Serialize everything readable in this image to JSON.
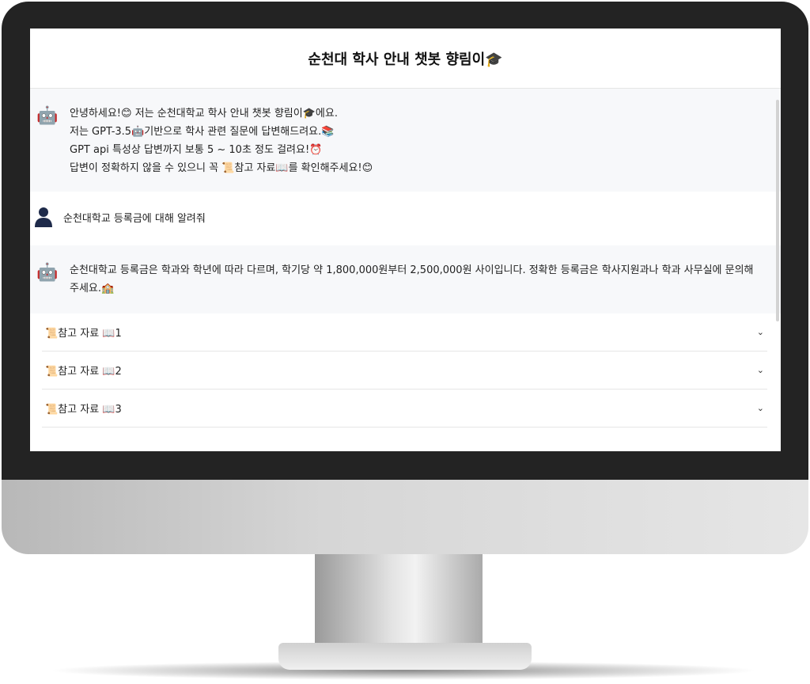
{
  "header": {
    "title": "순천대 학사 안내 챗봇 향림이🎓"
  },
  "messages": [
    {
      "role": "assistant",
      "lines": [
        "안녕하세요!😊 저는 순천대학교 학사 안내 챗봇 향림이🎓에요.",
        "저는 GPT-3.5🤖기반으로 학사 관련 질문에 답변해드려요.📚",
        "GPT api 특성상 답변까지 보통 5 ~ 10초 정도 걸려요!⏰",
        "답변이 정확하지 않을 수 있으니 꼭 📜참고 자료📖를 확인해주세요!😊"
      ]
    },
    {
      "role": "user",
      "text": "순천대학교 등록금에 대해 알려줘"
    },
    {
      "role": "assistant",
      "text": "순천대학교 등록금은 학과와 학년에 따라 다르며, 학기당 약 1,800,000원부터 2,500,000원 사이입니다. 정확한 등록금은 학사지원과나 학과 사무실에 문의해주세요.🏫"
    }
  ],
  "references": [
    {
      "label": "📜참고 자료 📖1"
    },
    {
      "label": "📜참고 자료 📖2"
    },
    {
      "label": "📜참고 자료 📖3"
    }
  ]
}
